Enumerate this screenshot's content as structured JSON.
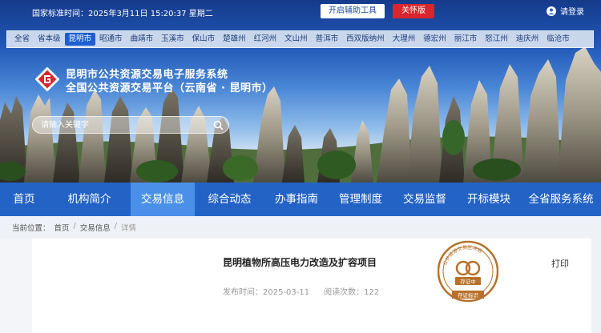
{
  "topbar": {
    "clock_label": "国家标准时间：",
    "clock_value": "2025年3月11日 15:20:37 星期二",
    "assist_button": "开启辅助工具",
    "care_button": "关怀版",
    "login_label": "请登录"
  },
  "regions": [
    "全省",
    "省本级",
    "昆明市",
    "昭通市",
    "曲靖市",
    "玉溪市",
    "保山市",
    "楚雄州",
    "红河州",
    "文山州",
    "普洱市",
    "西双版纳州",
    "大理州",
    "德宏州",
    "丽江市",
    "怒江州",
    "迪庆州",
    "临沧市"
  ],
  "active_region": "昆明市",
  "site": {
    "title_line1": "昆明市公共资源交易电子服务系统",
    "title_line2": "全国公共资源交易平台（云南省 · 昆明市）"
  },
  "search": {
    "placeholder": "请输入关键字"
  },
  "nav": [
    "首页",
    "机构简介",
    "交易信息",
    "综合动态",
    "办事指南",
    "管理制度",
    "交易监督",
    "开标模块",
    "全省服务系统"
  ],
  "active_nav": "交易信息",
  "breadcrumb": {
    "prefix": "当前位置：",
    "items": [
      "首页",
      "交易信息",
      "详情"
    ]
  },
  "article": {
    "title": "昆明植物所高压电力改造及扩容项目",
    "published_label": "发布时间：",
    "published": "2025-03-11",
    "views_label": "阅读次数：",
    "views": "122",
    "print_label": "打印"
  },
  "seal": {
    "ring_text": "公共资源交易区块链",
    "center_text": "存证中",
    "bottom_text": "存证标识"
  },
  "colors": {
    "nav": "#2463c6",
    "nav_active": "#4a90e8",
    "region_active": "#1d5fcf",
    "care": "#d9252e",
    "seal": "#b8712a"
  }
}
